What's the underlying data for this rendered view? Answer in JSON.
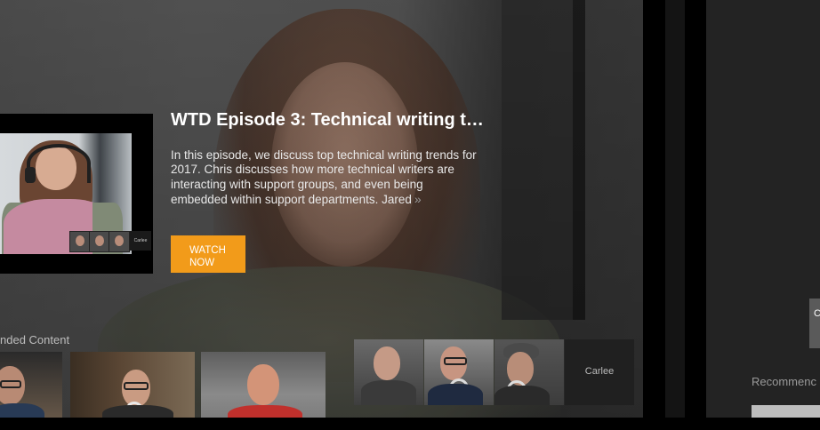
{
  "featured": {
    "title": "WTD Episode 3: Technical writing t…",
    "description": "In this episode, we discuss top technical writing trends for 2017. Chris discusses how more technical writers are interacting with support groups, and even being embedded within support departments. Jared",
    "more_icon": "chevron-double-right-icon",
    "more_glyph": "»",
    "watch_label_line1": "WATCH",
    "watch_label_line2": "NOW",
    "thumbnail_participant_label": "Carlee"
  },
  "recommended": {
    "label": "nded Content",
    "label_right": "Recommenc",
    "tiles": [
      {
        "name": "recommended-tile-1"
      },
      {
        "name": "recommended-tile-2"
      },
      {
        "name": "recommended-tile-3"
      },
      {
        "name": "recommended-tile-4",
        "participant_label": "Carlee"
      }
    ]
  },
  "right_panel": {
    "edge_letter": "C"
  },
  "colors": {
    "accent": "#f29b1a",
    "background": "#000000",
    "panel_right": "#232323"
  }
}
